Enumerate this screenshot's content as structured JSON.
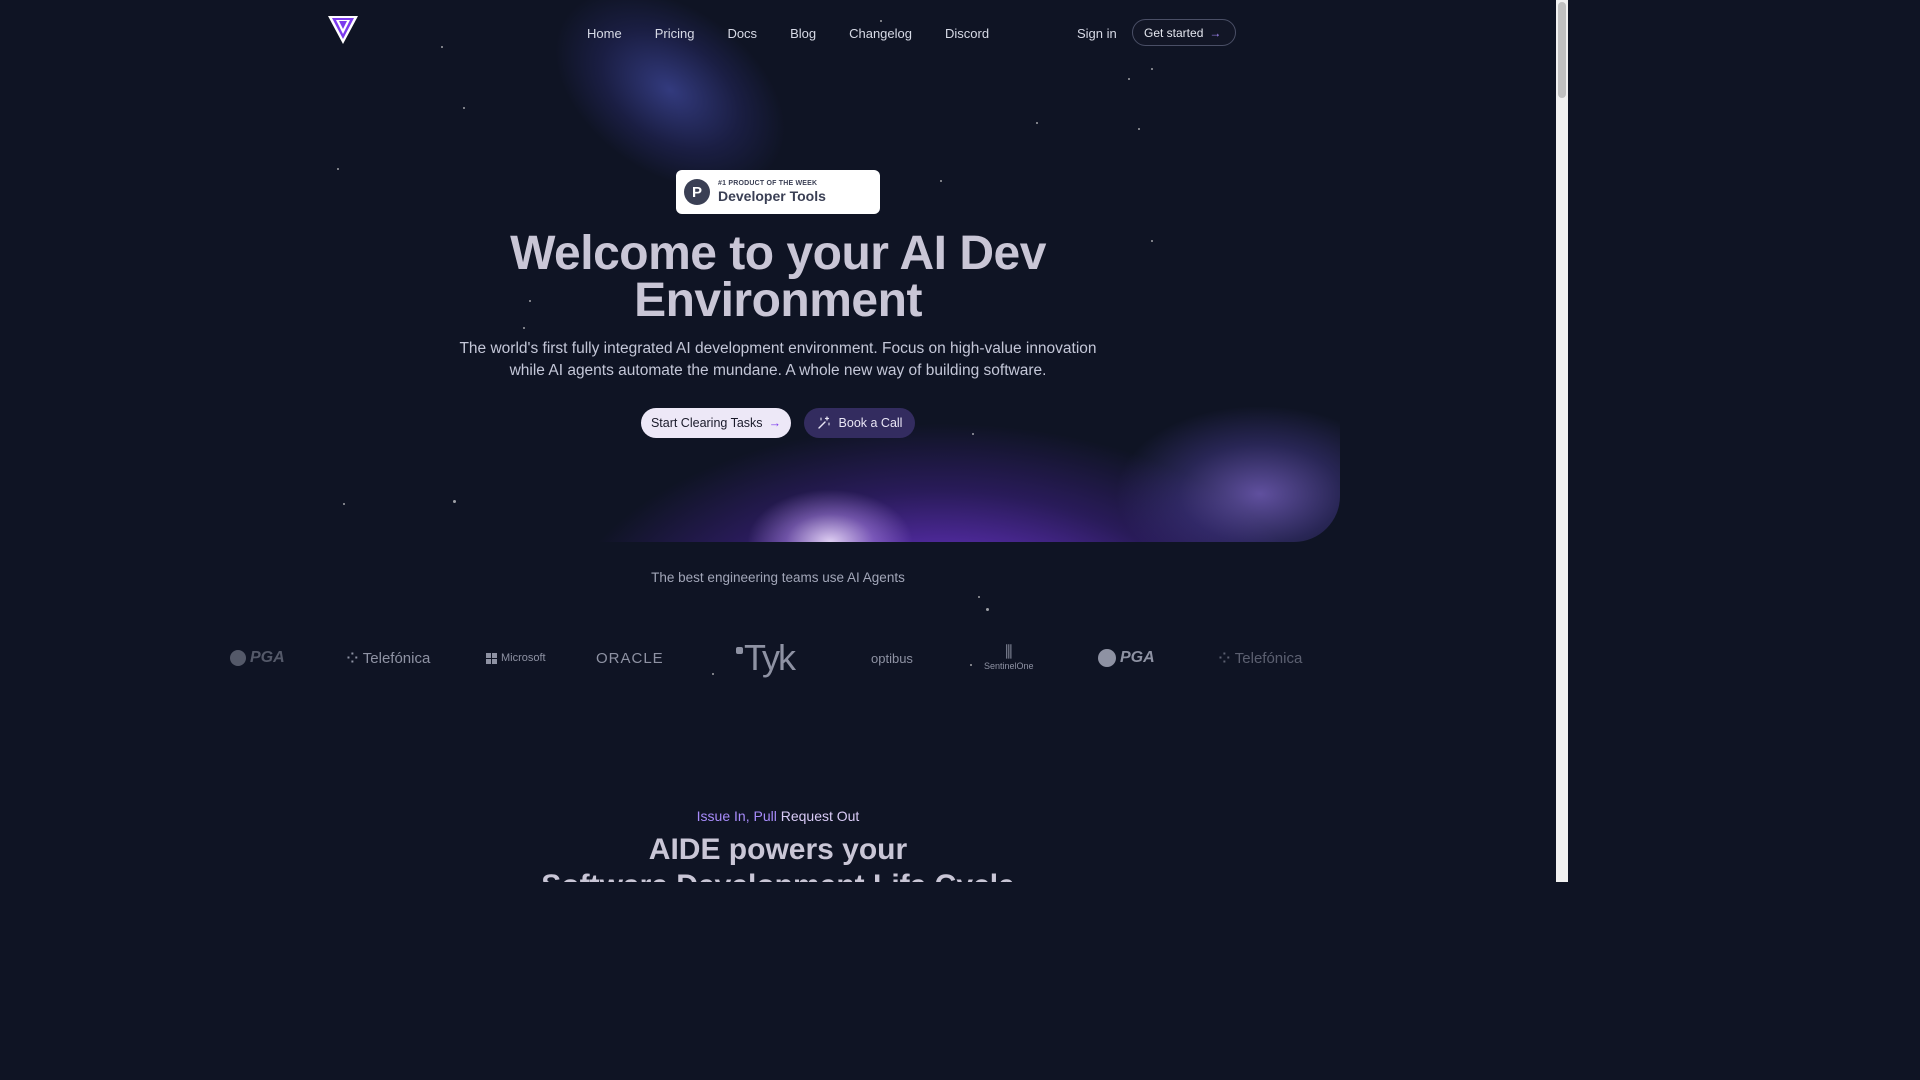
{
  "nav": {
    "links": [
      "Home",
      "Pricing",
      "Docs",
      "Blog",
      "Changelog",
      "Discord"
    ],
    "sign_in": "Sign in",
    "get_started": "Get started",
    "get_started_arrow": "→"
  },
  "badge": {
    "letter": "P",
    "small": "#1 PRODUCT OF THE WEEK",
    "big": "Developer Tools"
  },
  "hero": {
    "title_line1": "Welcome to your AI Dev",
    "title_line2": "Environment",
    "subtitle_line1": "The world's first fully integrated AI development environment. Focus on high-value innovation",
    "subtitle_line2": "while AI agents automate the mundane. A whole new way of building software.",
    "cta_primary": "Start Clearing Tasks",
    "cta_primary_arrow": "→",
    "cta_secondary": "Book a Call"
  },
  "teams": {
    "label": "The best engineering teams use AI Agents",
    "brands": [
      "PGA",
      "Telefónica",
      "Microsoft",
      "ORACLE",
      "Tyk",
      "optibus",
      "SentinelOne",
      "PGA",
      "Telefónica"
    ]
  },
  "section": {
    "eyebrow_part1": "Issue In, Pull",
    "eyebrow_part2": "Request Out",
    "title_line1": "AIDE powers your",
    "title_line2": "Software Development Life Cycle"
  },
  "colors": {
    "background": "#0f1424",
    "accent": "#a78bfa",
    "glow": "#7c3aed"
  }
}
